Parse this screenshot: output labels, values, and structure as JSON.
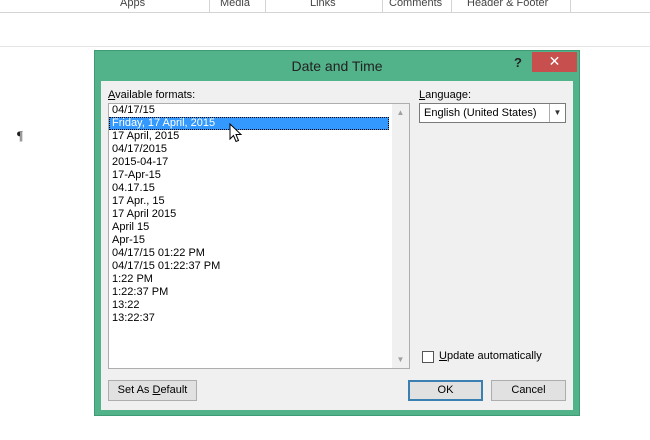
{
  "ribbon": {
    "groups": [
      "Apps",
      "Media",
      "Links",
      "Comments",
      "Header & Footer"
    ]
  },
  "dialog": {
    "title": "Date and Time",
    "help_label": "?",
    "close_label": "✕",
    "available_formats_label_prefix": "",
    "available_formats_label_access": "A",
    "available_formats_label_rest": "vailable formats:",
    "formats": [
      "04/17/15",
      "Friday, 17 April, 2015",
      "17 April, 2015",
      "04/17/2015",
      "2015-04-17",
      "17-Apr-15",
      "04.17.15",
      "17 Apr., 15",
      "17 April 2015",
      "April 15",
      "Apr-15",
      "04/17/15 01:22 PM",
      "04/17/15 01:22:37 PM",
      "1:22 PM",
      "1:22:37 PM",
      "13:22",
      "13:22:37"
    ],
    "selected_index": 1,
    "language_label_access": "L",
    "language_label_rest": "anguage:",
    "language_value": "English (United States)",
    "update_auto_access": "U",
    "update_auto_rest": "pdate automatically",
    "update_auto_checked": false,
    "set_default_prefix": "Set As ",
    "set_default_access": "D",
    "set_default_rest": "efault",
    "ok_label": "OK",
    "cancel_label": "Cancel"
  },
  "document": {
    "pilcrow": "¶"
  }
}
